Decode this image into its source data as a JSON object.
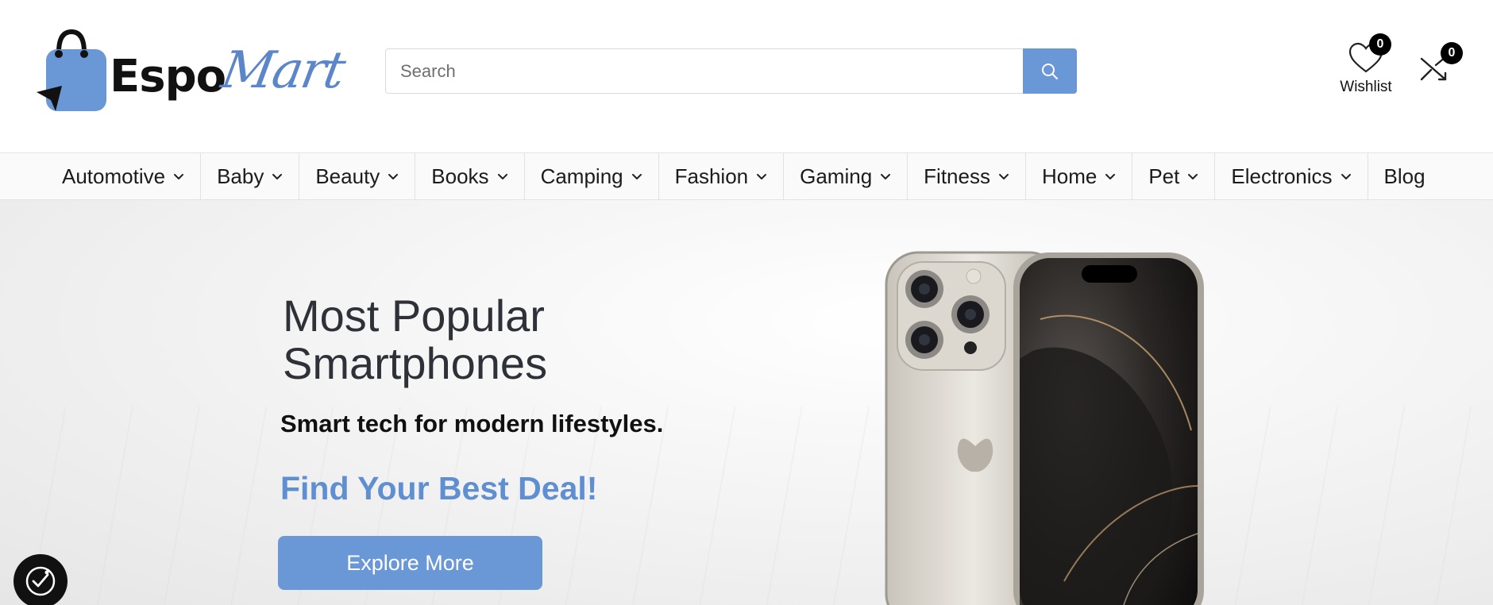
{
  "brand": {
    "name_part1": "Espo",
    "name_part2": "Mart",
    "accent_color": "#5b86c9"
  },
  "search": {
    "placeholder": "Search",
    "value": "",
    "button_icon": "search-icon"
  },
  "header_actions": {
    "wishlist": {
      "label": "Wishlist",
      "count": "0",
      "icon": "heart-icon"
    },
    "compare": {
      "count": "0",
      "icon": "shuffle-icon"
    }
  },
  "nav": {
    "items": [
      {
        "label": "Automotive",
        "has_dropdown": true
      },
      {
        "label": "Baby",
        "has_dropdown": true
      },
      {
        "label": "Beauty",
        "has_dropdown": true
      },
      {
        "label": "Books",
        "has_dropdown": true
      },
      {
        "label": "Camping",
        "has_dropdown": true
      },
      {
        "label": "Fashion",
        "has_dropdown": true
      },
      {
        "label": "Gaming",
        "has_dropdown": true
      },
      {
        "label": "Fitness",
        "has_dropdown": true
      },
      {
        "label": "Home",
        "has_dropdown": true
      },
      {
        "label": "Pet",
        "has_dropdown": true
      },
      {
        "label": "Electronics",
        "has_dropdown": true
      },
      {
        "label": "Blog",
        "has_dropdown": false
      }
    ]
  },
  "hero": {
    "title_line1": "Most Popular",
    "title_line2": "Smartphones",
    "subtitle": "Smart tech for modern lifestyles.",
    "deal_text": "Find Your Best Deal!",
    "cta_label": "Explore More",
    "deal_color": "#5f8fd1",
    "button_color": "#6a97d6"
  },
  "accessibility": {
    "icon": "accessibility-icon"
  }
}
